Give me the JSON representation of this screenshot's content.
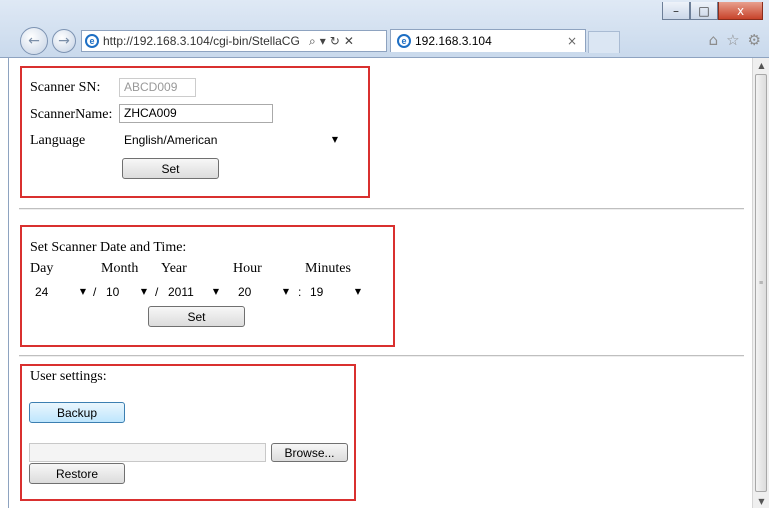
{
  "browser": {
    "address": "http://192.168.3.104/cgi-bin/StellaCG",
    "tab_title": "192.168.3.104",
    "tab_close": "×",
    "icons": [
      "back-arrow-icon",
      "forward-arrow-icon",
      "ie-logo-icon",
      "search-icon",
      "compat-view-icon",
      "refresh-icon",
      "stop-icon",
      "home-icon",
      "favorites-star-icon",
      "settings-gear-icon"
    ],
    "window_buttons": {
      "minimize": "–",
      "maximize": "□",
      "close": "x"
    }
  },
  "scanner": {
    "sn_label": "Scanner SN:",
    "sn_value": "ABCD009",
    "name_label": "ScannerName:",
    "name_value": "ZHCA009",
    "language_label": "Language",
    "language_value": "English/American",
    "set_label": "Set"
  },
  "datetime": {
    "title": "Set Scanner Date and Time:",
    "headers": {
      "day": "Day",
      "month": "Month",
      "year": "Year",
      "hour": "Hour",
      "minutes": "Minutes"
    },
    "values": {
      "day": "24",
      "month": "10",
      "year": "2011",
      "hour": "20",
      "minutes": "19"
    },
    "sep_slash": "/",
    "sep_colon": ":",
    "set_label": "Set"
  },
  "user": {
    "title": "User settings:",
    "backup_label": "Backup",
    "file_value": "",
    "browse_label": "Browse...",
    "restore_label": "Restore"
  },
  "colors": {
    "highlight_border": "#d9302f",
    "chrome": "#c9d9ec"
  }
}
